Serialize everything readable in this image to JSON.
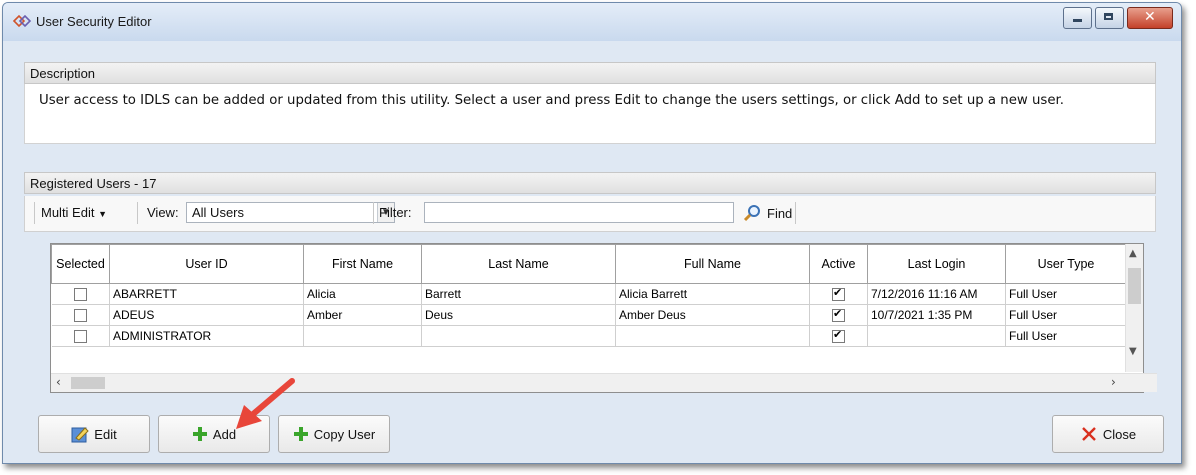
{
  "window": {
    "title": "User Security Editor"
  },
  "description": {
    "header": "Description",
    "text": "User access to IDLS can be added or updated from this utility.  Select a user and press Edit to change the users settings, or click Add to set up a new user."
  },
  "users_panel": {
    "header": "Registered Users - 17",
    "toolbar": {
      "multi_edit_label": "Multi Edit",
      "view_label": "View:",
      "view_value": "All Users",
      "filter_label": "Filter:",
      "filter_value": "",
      "find_label": "Find"
    },
    "columns": [
      "Selected",
      "User ID",
      "First Name",
      "Last Name",
      "Full Name",
      "Active",
      "Last Login",
      "User Type"
    ],
    "rows": [
      {
        "selected": false,
        "user_id": "ABARRETT",
        "first_name": "Alicia",
        "last_name": "Barrett",
        "full_name": "Alicia Barrett",
        "active": true,
        "last_login": "7/12/2016 11:16 AM",
        "user_type": "Full User"
      },
      {
        "selected": false,
        "user_id": "ADEUS",
        "first_name": "Amber",
        "last_name": "Deus",
        "full_name": "Amber Deus",
        "active": true,
        "last_login": "10/7/2021 1:35 PM",
        "user_type": "Full User"
      },
      {
        "selected": false,
        "user_id": "ADMINISTRATOR",
        "first_name": "",
        "last_name": "",
        "full_name": "",
        "active": true,
        "last_login": "",
        "user_type": "Full User"
      }
    ]
  },
  "buttons": {
    "edit": "Edit",
    "add": "Add",
    "copy_user": "Copy User",
    "close": "Close"
  },
  "colors": {
    "accent_arrow": "#e8463a",
    "plus_green": "#3aa52b",
    "close_x": "#d9301f"
  }
}
